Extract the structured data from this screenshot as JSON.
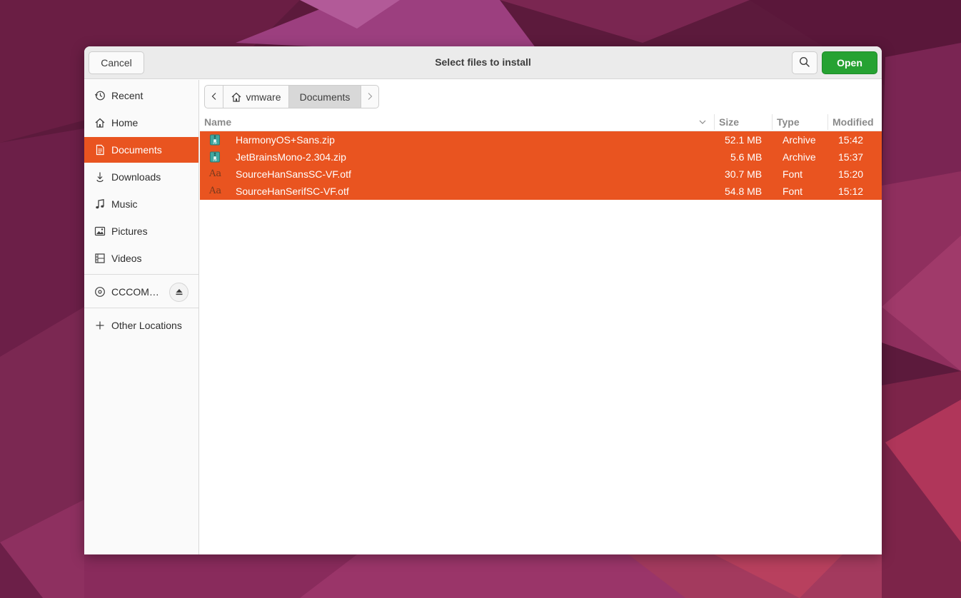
{
  "dialog": {
    "title": "Select files to install",
    "cancel_label": "Cancel",
    "open_label": "Open"
  },
  "sidebar": {
    "items": [
      {
        "label": "Recent",
        "icon": "clock-icon"
      },
      {
        "label": "Home",
        "icon": "home-icon"
      },
      {
        "label": "Documents",
        "icon": "document-icon",
        "active": true
      },
      {
        "label": "Downloads",
        "icon": "download-icon"
      },
      {
        "label": "Music",
        "icon": "music-icon"
      },
      {
        "label": "Pictures",
        "icon": "picture-icon"
      },
      {
        "label": "Videos",
        "icon": "film-icon"
      }
    ],
    "device": {
      "label": "CCCOM…",
      "icon": "disc-icon"
    },
    "other": {
      "label": "Other Locations",
      "icon": "plus-icon"
    }
  },
  "pathbar": {
    "home_label": "vmware",
    "current_label": "Documents"
  },
  "columns": {
    "name": "Name",
    "size": "Size",
    "type": "Type",
    "modified": "Modified"
  },
  "files": [
    {
      "name": "HarmonyOS+Sans.zip",
      "size": "52.1 MB",
      "type": "Archive",
      "modified": "15:42",
      "icon": "archive-icon"
    },
    {
      "name": "JetBrainsMono-2.304.zip",
      "size": "5.6 MB",
      "type": "Archive",
      "modified": "15:37",
      "icon": "archive-icon"
    },
    {
      "name": "SourceHanSansSC-VF.otf",
      "size": "30.7 MB",
      "type": "Font",
      "modified": "15:20",
      "icon": "font-icon",
      "icon_text": "Aa"
    },
    {
      "name": "SourceHanSerifSC-VF.otf",
      "size": "54.8 MB",
      "type": "Font",
      "modified": "15:12",
      "icon": "font-icon",
      "icon_text": "Aa"
    }
  ],
  "colors": {
    "accent": "#e95420",
    "open_button": "#26a232",
    "wallpaper": "#6b1f45"
  }
}
